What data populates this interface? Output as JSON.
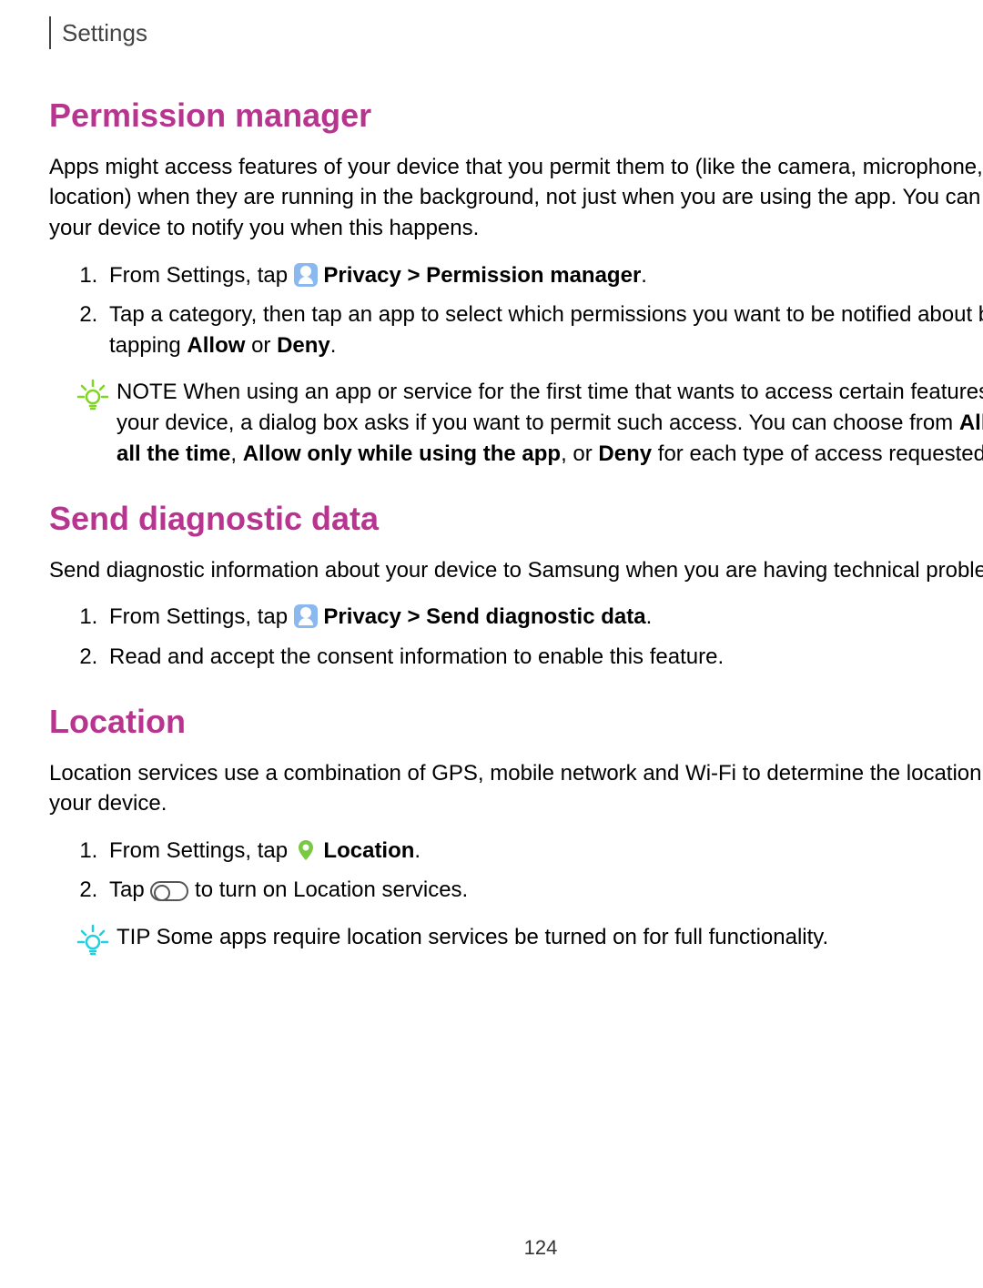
{
  "header": "Settings",
  "section1": {
    "title": "Permission manager",
    "intro": "Apps might access features of your device that you permit them to (like the camera, microphone, or location) when they are running in the background, not just when you are using the app. You can set your device to notify you when this happens.",
    "step1_pre": "From Settings, tap ",
    "step1_bold": "Privacy > Permission manager",
    "step1_post": ".",
    "step2_a": "Tap a category, then tap an app to select which permissions you want to be notified about by tapping ",
    "step2_b1": "Allow",
    "step2_b_or": " or ",
    "step2_b2": "Deny",
    "step2_c": ".",
    "note_label": "NOTE",
    "note_a": "  When using an app or service for the first time that wants to access certain features of your device, a dialog box asks if you want to permit such access. You can choose from ",
    "note_b1": "Allow all the time",
    "note_sep1": ", ",
    "note_b2": "Allow only while using the app",
    "note_sep2": ", or ",
    "note_b3": "Deny",
    "note_c": " for each type of access requested."
  },
  "section2": {
    "title": "Send diagnostic data",
    "intro": "Send diagnostic information about your device to Samsung when you are having technical problems.",
    "step1_pre": "From Settings, tap ",
    "step1_bold": "Privacy > Send diagnostic data",
    "step1_post": ".",
    "step2": "Read and accept the consent information to enable this feature."
  },
  "section3": {
    "title": "Location",
    "intro": "Location services use a combination of GPS, mobile network and Wi-Fi to determine the location of your device.",
    "step1_pre": "From Settings, tap ",
    "step1_bold": "Location",
    "step1_post": ".",
    "step2_pre": "Tap ",
    "step2_post": " to turn on Location services.",
    "tip_label": "TIP",
    "tip_text": "  Some apps require location services be turned on for full functionality."
  },
  "page_number": "124"
}
